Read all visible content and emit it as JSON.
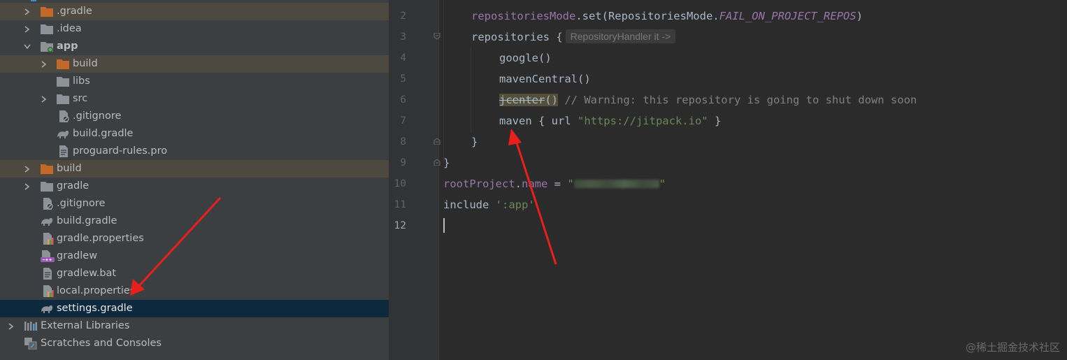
{
  "project_tree": {
    "items": [
      {
        "label": ".gradle",
        "icon": "folder-orange-icon",
        "expanded": false,
        "excluded": true
      },
      {
        "label": ".idea",
        "icon": "folder-icon",
        "expanded": false
      },
      {
        "label": "app",
        "icon": "module-folder-icon",
        "expanded": true
      },
      {
        "label": "build",
        "icon": "folder-orange-icon",
        "expanded": false,
        "excluded": true
      },
      {
        "label": "libs",
        "icon": "folder-icon"
      },
      {
        "label": "src",
        "icon": "folder-icon",
        "expanded": false
      },
      {
        "label": ".gitignore",
        "icon": "ignore-file-icon"
      },
      {
        "label": "build.gradle",
        "icon": "gradle-icon"
      },
      {
        "label": "proguard-rules.pro",
        "icon": "text-file-icon"
      },
      {
        "label": "build",
        "icon": "folder-orange-icon",
        "expanded": false,
        "excluded": true
      },
      {
        "label": "gradle",
        "icon": "folder-icon",
        "expanded": false
      },
      {
        "label": ".gitignore",
        "icon": "ignore-file-icon"
      },
      {
        "label": "build.gradle",
        "icon": "gradle-icon"
      },
      {
        "label": "gradle.properties",
        "icon": "properties-file-icon"
      },
      {
        "label": "gradlew",
        "icon": "shell-script-icon"
      },
      {
        "label": "gradlew.bat",
        "icon": "text-file-icon"
      },
      {
        "label": "local.properties",
        "icon": "properties-file-icon"
      },
      {
        "label": "settings.gradle",
        "icon": "gradle-icon",
        "selected": true
      },
      {
        "label": "External Libraries",
        "icon": "libraries-icon",
        "expanded": false
      },
      {
        "label": "Scratches and Consoles",
        "icon": "scratches-icon"
      }
    ]
  },
  "editor": {
    "line_numbers": [
      "2",
      "3",
      "4",
      "5",
      "6",
      "7",
      "8",
      "9",
      "10",
      "11",
      "12"
    ],
    "current_line": "12",
    "lines": {
      "l2_a": "repositoriesMode",
      "l2_b": ".set(RepositoriesMode.",
      "l2_c": "FAIL_ON_PROJECT_REPOS",
      "l2_d": ")",
      "l3_a": "repositories {",
      "l3_hint": "RepositoryHandler it ->",
      "l4": "google()",
      "l5": "mavenCentral()",
      "l6_a": "jcenter",
      "l6_b": "()",
      "l6_c": " // Warning: this repository is going to shut down soon",
      "l7_a": "maven { url ",
      "l7_b": "\"https://jitpack.io\"",
      "l7_c": " }",
      "l8": "}",
      "l9": "}",
      "l10_a": "rootProject",
      "l10_b": ".",
      "l10_c": "name",
      "l10_d": " = ",
      "l10_e": "\"",
      "l10_f": "\"",
      "l11_a": "include ",
      "l11_b": "':app'"
    }
  },
  "watermark": "@稀土掘金技术社区",
  "colors": {
    "tree_bg": "#3c3f41",
    "editor_bg": "#2b2b2b",
    "selection": "#0d293e",
    "excluded_row": "#4d4941",
    "field_purple": "#9876aa",
    "string_green": "#6a8759",
    "annotation_red": "#e8201c"
  }
}
